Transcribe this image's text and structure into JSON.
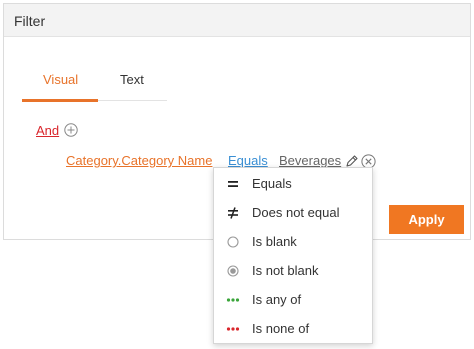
{
  "panel": {
    "title": "Filter"
  },
  "tabs": [
    {
      "label": "Visual",
      "active": true
    },
    {
      "label": "Text",
      "active": false
    }
  ],
  "condition": {
    "logic_label": "And",
    "field_label": "Category.Category Name",
    "operator_label": "Equals",
    "value_label": "Beverages"
  },
  "apply": {
    "label": "Apply"
  },
  "dropdown": {
    "items": [
      {
        "label": "Equals",
        "icon": "equals-icon"
      },
      {
        "label": "Does not equal",
        "icon": "not-equal-icon"
      },
      {
        "label": "Is blank",
        "icon": "empty-radio-icon"
      },
      {
        "label": "Is not blank",
        "icon": "filled-radio-icon"
      },
      {
        "label": "Is any of",
        "icon": "green-dots-icon"
      },
      {
        "label": "Is none of",
        "icon": "red-dots-icon"
      }
    ]
  },
  "colors": {
    "accent": "#e8732a",
    "apply_button": "#f07722",
    "logic_link": "#d9262c",
    "operator_link": "#3a8fd4",
    "any_of_dots": "#3aa53a",
    "none_of_dots": "#d9262c"
  }
}
